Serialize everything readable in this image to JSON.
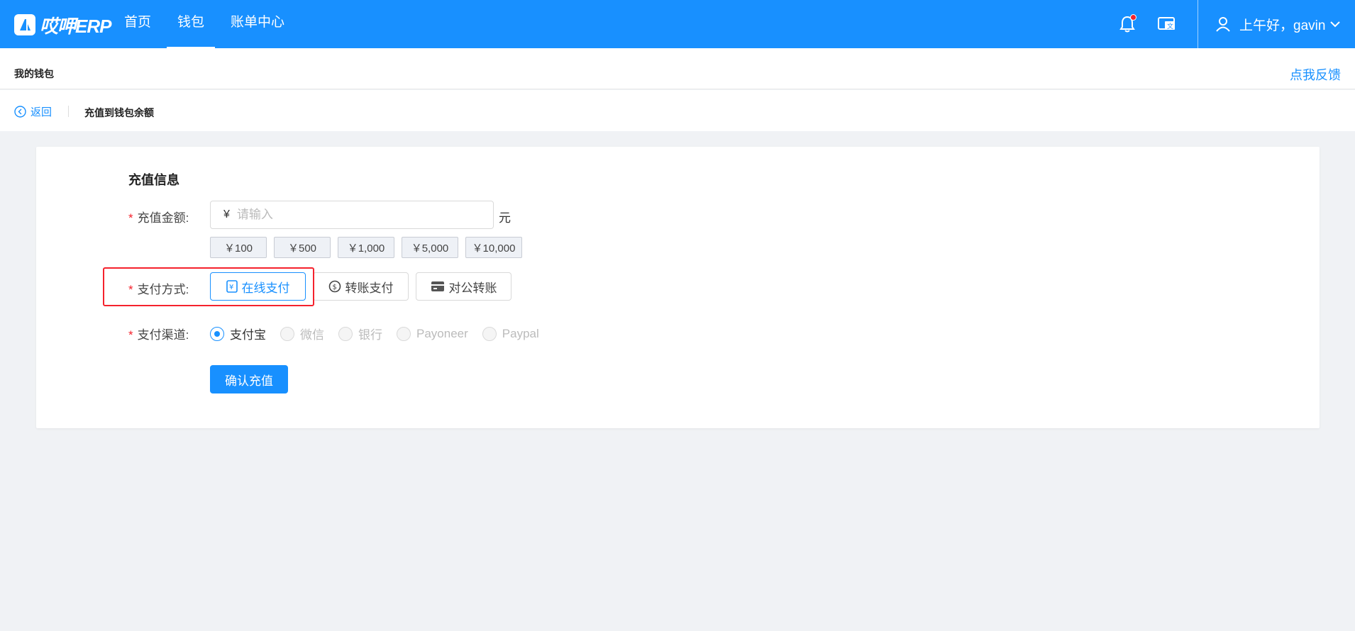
{
  "header": {
    "logo_text": "哎呷ERP",
    "nav": [
      {
        "label": "首页"
      },
      {
        "label": "钱包"
      },
      {
        "label": "账单中心"
      }
    ],
    "user_greeting": "上午好，gavin"
  },
  "page": {
    "section_title": "我的钱包",
    "feedback_label": "点我反馈",
    "back_label": "返回",
    "subpage_title": "充值到钱包余额"
  },
  "form": {
    "title": "充值信息",
    "amount": {
      "label": "充值金额:",
      "currency_symbol": "¥",
      "placeholder": "请输入",
      "value": "",
      "unit": "元"
    },
    "quick_amounts": [
      "￥100",
      "￥500",
      "￥1,000",
      "￥5,000",
      "￥10,000"
    ],
    "pay_method": {
      "label": "支付方式:",
      "options": [
        "在线支付",
        "转账支付",
        "对公转账"
      ],
      "selected": "在线支付"
    },
    "pay_channel": {
      "label": "支付渠道:",
      "options": [
        "支付宝",
        "微信",
        "银行",
        "Payoneer",
        "Paypal"
      ],
      "selected": "支付宝"
    },
    "submit_label": "确认充值"
  },
  "colors": {
    "primary": "#1890ff",
    "required": "#f5222d",
    "background": "#f0f2f5"
  },
  "icons": [
    "logo-icon",
    "bell-icon",
    "language-icon",
    "user-icon",
    "chevron-down-icon",
    "back-circle-icon",
    "online-pay-icon",
    "transfer-icon",
    "card-icon"
  ]
}
